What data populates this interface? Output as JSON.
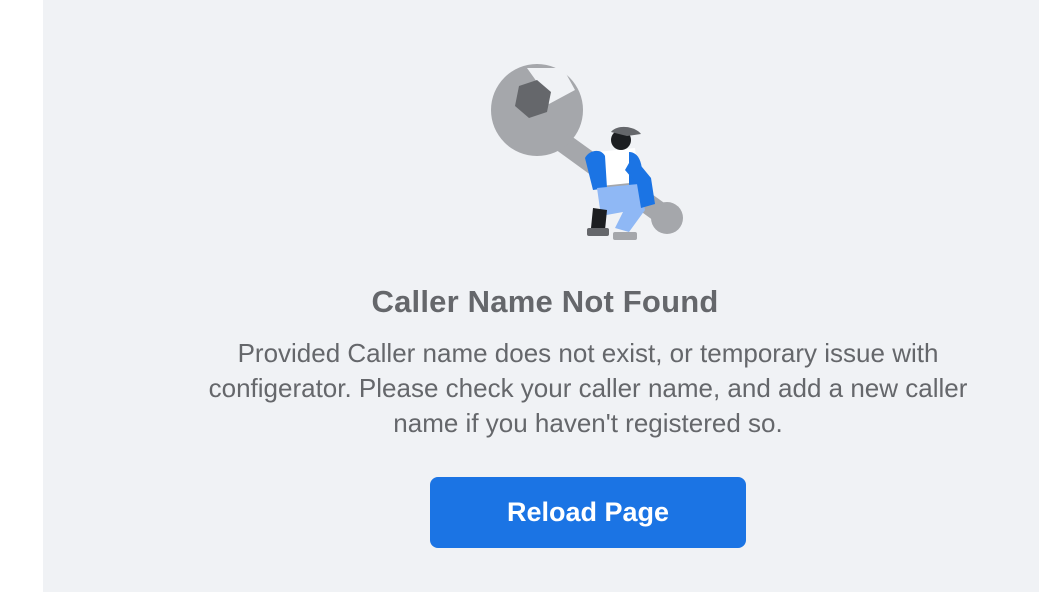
{
  "error": {
    "illustration_icon": "wrench-with-person-icon",
    "title": "Caller Name Not Found",
    "message": "Provided Caller name does not exist, or temporary issue with configerator. Please check your caller name, and add a new caller name if you haven't registered so.",
    "button_label": "Reload Page"
  },
  "colors": {
    "panel_background": "#f0f2f5",
    "text": "#65676b",
    "button": "#1b74e4",
    "button_text": "#ffffff"
  }
}
